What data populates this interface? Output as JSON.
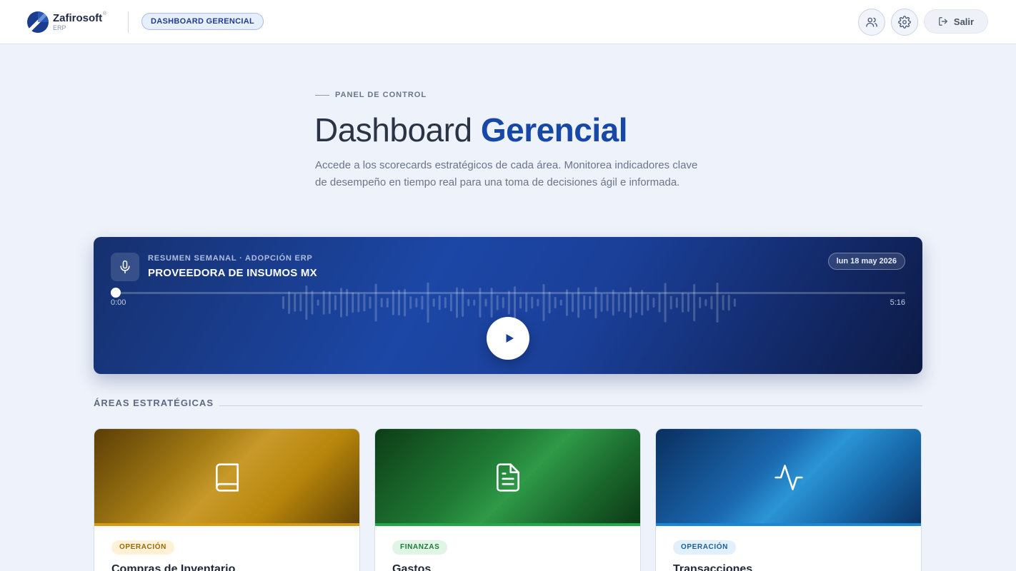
{
  "header": {
    "logo_name": "Zafirosoft",
    "logo_sub": "ERP",
    "logo_reg": "®",
    "badge": "DASHBOARD GERENCIAL",
    "logout_label": "Salir"
  },
  "hero": {
    "eyebrow": "PANEL DE CONTROL",
    "title_light": "Dashboard ",
    "title_bold": "Gerencial",
    "description": "Accede a los scorecards estratégicos de cada área. Monitorea indicadores clave de desempeño en tiempo real para una toma de decisiones ágil e informada."
  },
  "audio": {
    "kicker": "RESUMEN SEMANAL · ADOPCIÓN ERP",
    "title": "PROVEEDORA DE INSUMOS MX",
    "date": "lun 18 may 2026",
    "time_current": "0:00",
    "time_total": "5:16",
    "progress": 0,
    "colors": {
      "accent": "#1c47a6",
      "dark": "#0d1a45"
    }
  },
  "section": {
    "title": "ÁREAS ESTRATÉGICAS"
  },
  "cards": [
    {
      "tag": "OPERACIÓN",
      "title": "Compras de Inventario",
      "icon": "book-icon",
      "color": "#d89b10"
    },
    {
      "tag": "FINANZAS",
      "title": "Gastos",
      "icon": "file-text-icon",
      "color": "#22a84a"
    },
    {
      "tag": "OPERACIÓN",
      "title": "Transacciones",
      "icon": "activity-icon",
      "color": "#1b86d4"
    }
  ]
}
